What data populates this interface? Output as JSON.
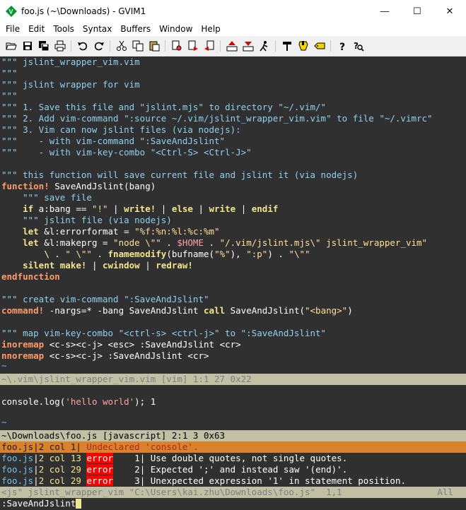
{
  "window": {
    "title": "foo.js (~\\Downloads) - GVIM1",
    "minimize_label": "—",
    "maximize_label": "☐",
    "close_label": "✕"
  },
  "menu": [
    "File",
    "Edit",
    "Tools",
    "Syntax",
    "Buffers",
    "Window",
    "Help"
  ],
  "toolbar": {
    "icons": [
      "open-icon",
      "save-icon",
      "save-all-icon",
      "print-icon",
      "undo-icon",
      "redo-icon",
      "cut-icon",
      "copy-icon",
      "paste-icon",
      "find-replace-icon",
      "find-next-icon",
      "find-prev-icon",
      "load-session-icon",
      "save-session-icon",
      "run-script-icon",
      "make-icon",
      "shell-icon",
      "tags-icon",
      "help-icon",
      "find-help-icon"
    ]
  },
  "editor": {
    "top_lines": [
      "\"\"\" jslint_wrapper_vim.vim",
      "\"\"\"",
      "\"\"\" jslint wrapper for vim",
      "\"\"\"",
      "\"\"\" 1. Save this file and \"jslint.mjs\" to directory \"~/.vim/\"",
      "\"\"\" 2. Add vim-command \":source ~/.vim/jslint_wrapper_vim.vim\" to file \"~/.vimrc\"",
      "\"\"\" 3. Vim can now jslint files (via nodejs):",
      "\"\"\"    - with vim-command \":SaveAndJslint\"",
      "\"\"\"    - with vim-key-combo \"<Ctrl-S> <Ctrl-J>\"",
      "",
      "\"\"\" this function will save current file and jslint it (via nodejs)"
    ],
    "fn_def_kw": "function!",
    "fn_def_name": " SaveAndJslint(bang)",
    "body": {
      "c_save": "    \"\"\" save file",
      "if_kw": "    if",
      "if_cond": " a:bang == ",
      "if_bang": "\"!\"",
      "if_rest1": " | ",
      "write1": "write!",
      "if_rest2": " | ",
      "else_kw": "else",
      "if_rest3": " | ",
      "write2": "write",
      "if_rest4": " | ",
      "endif_kw": "endif",
      "c_jslint": "    \"\"\" jslint file (via nodejs)",
      "let1_kw": "    let",
      "let1_var": " &l:errorformat = ",
      "let1_val": "\"%f:%n:%l:%c:%m\"",
      "let2_kw": "    let",
      "let2_var": " &l:makeprg = ",
      "let2_s1": "\"node \\\"\"",
      "let2_dot1": " . ",
      "let2_home": "$HOME",
      "let2_dot2": " . ",
      "let2_s2": "\"/.vim/jslint.mjs\\\" jslint_wrapper_vim\"",
      "cont_bs": "        \\",
      "cont_dot1": " . ",
      "cont_s1": "\" \\\"\"",
      "cont_dot2": " . ",
      "cont_fn": "fnamemodify",
      "cont_mid": "(bufname(",
      "cont_s2": "\"%\"",
      "cont_mid2": "), ",
      "cont_s3": "\":p\"",
      "cont_mid3": ") . ",
      "cont_s4": "\"\\\"\"",
      "silent_kw": "    silent make!",
      "silent_p1": " | ",
      "cwindow_kw": "cwindow",
      "silent_p2": " | ",
      "redraw_kw": "redraw!",
      "endfunction_kw": "endfunction"
    },
    "c_create": "\"\"\" create vim-command \":SaveAndJslint\"",
    "cmd_kw": "command!",
    "cmd_rest1": " -nargs=* -bang ",
    "cmd_name": "SaveAndJslint ",
    "cmd_call": "call",
    "cmd_rest2": " SaveAndJslint(",
    "cmd_str": "\"<bang>\"",
    "cmd_close": ")",
    "c_map": "\"\"\" map vim-key-combo \"<ctrl-s> <ctrl-j>\" to \":SaveAndJslint\"",
    "inoremap_kw": "inoremap",
    "inoremap_keys": " <c-s><c-j> <esc>",
    "inoremap_rest": " :SaveAndJslint <cr>",
    "nnoremap_kw": "nnoremap",
    "nnoremap_keys": " <c-s><c-j>",
    "nnoremap_rest": " :SaveAndJslint <cr>",
    "tilde": "~",
    "status1": "~\\.vim\\jslint_wrapper_vim.vim [vim] 1:1 27 0x22",
    "foo_line1_a": "console.log(",
    "foo_line1_s": "'hello world'",
    "foo_line1_b": "); 1",
    "status2": "~\\Downloads\\foo.js [javascript] 2:1 3 0x63",
    "quickfix": [
      {
        "file": "foo.js",
        "pos": "2 col 1",
        "type": "",
        "num": "",
        "msg": " Undeclared 'console'."
      },
      {
        "file": "foo.js",
        "pos": "2 col 13",
        "type": "error",
        "num": "1",
        "msg": " Use double quotes, not single quotes."
      },
      {
        "file": "foo.js",
        "pos": "2 col 29",
        "type": "error",
        "num": "2",
        "msg": " Expected ';' and instead saw '(end)'."
      },
      {
        "file": "foo.js",
        "pos": "2 col 29",
        "type": "error",
        "num": "3",
        "msg": " Unexpected expression '1' in statement position."
      }
    ],
    "status3_left": "<js\" jslint_wrapper_vim \"C:\\Users\\kai.zhu\\Downloads\\foo.js\"  1,1",
    "status3_right": "All",
    "cmdline": ":SaveAndJslint"
  },
  "colors": {
    "editor_bg": "#303030",
    "comment": "#8ed1f0",
    "string": "#fce094",
    "keyword": "#f0e68c",
    "statusline": "#c2bfa5",
    "quickfix_selected": "#d9822b",
    "error_bg": "#ff0000"
  }
}
